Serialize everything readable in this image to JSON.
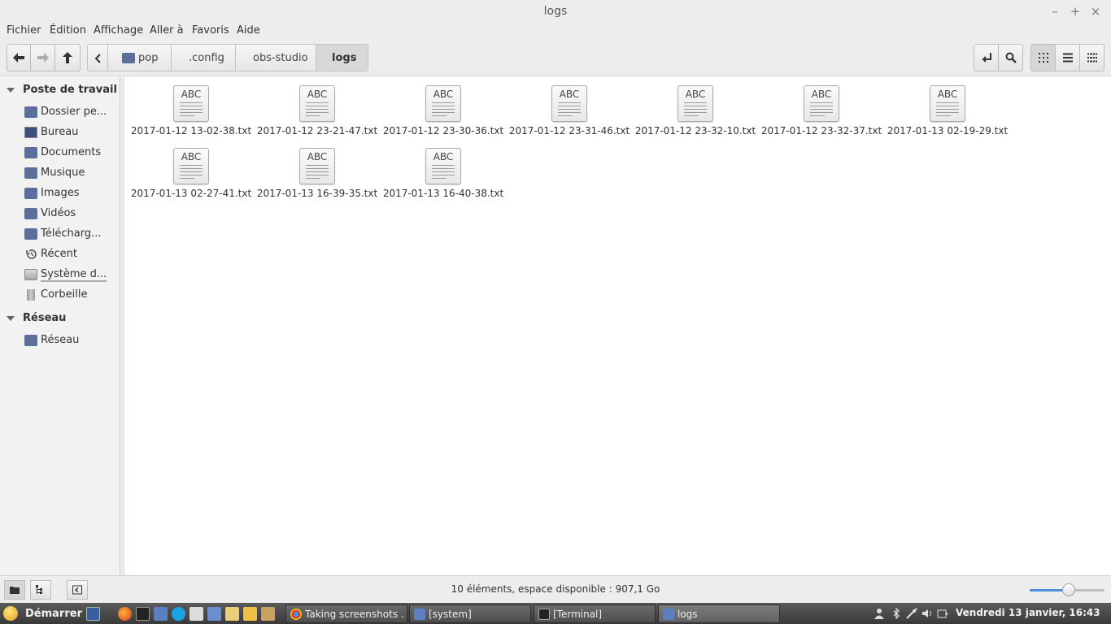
{
  "window": {
    "title": "logs",
    "controls": {
      "minimize": "–",
      "maximize": "+",
      "close": "×"
    }
  },
  "menubar": [
    "Fichier",
    "Édition",
    "Affichage",
    "Aller à",
    "Favoris",
    "Aide"
  ],
  "breadcrumb": [
    "pop",
    ".config",
    "obs-studio",
    "logs"
  ],
  "sidebar": {
    "sections": [
      {
        "label": "Poste de travail"
      },
      {
        "label": "Réseau"
      }
    ],
    "items": [
      {
        "label": "Dossier pe...",
        "icon": "home-folder-icon"
      },
      {
        "label": "Bureau",
        "icon": "desktop-icon"
      },
      {
        "label": "Documents",
        "icon": "documents-folder-icon"
      },
      {
        "label": "Musique",
        "icon": "music-folder-icon"
      },
      {
        "label": "Images",
        "icon": "pictures-folder-icon"
      },
      {
        "label": "Vidéos",
        "icon": "videos-folder-icon"
      },
      {
        "label": "Télécharg...",
        "icon": "downloads-folder-icon"
      },
      {
        "label": "Récent",
        "icon": "recent-icon"
      },
      {
        "label": "Système d...",
        "icon": "drive-icon"
      },
      {
        "label": "Corbeille",
        "icon": "trash-icon"
      }
    ],
    "network_items": [
      {
        "label": "Réseau",
        "icon": "network-icon"
      }
    ]
  },
  "files": [
    {
      "name": "2017-01-12 13-02-38.txt",
      "thumb": "ABC"
    },
    {
      "name": "2017-01-12 23-21-47.txt",
      "thumb": "ABC"
    },
    {
      "name": "2017-01-12 23-30-36.txt",
      "thumb": "ABC"
    },
    {
      "name": "2017-01-12 23-31-46.txt",
      "thumb": "ABC"
    },
    {
      "name": "2017-01-12 23-32-10.txt",
      "thumb": "ABC"
    },
    {
      "name": "2017-01-12 23-32-37.txt",
      "thumb": "ABC"
    },
    {
      "name": "2017-01-13 02-19-29.txt",
      "thumb": "ABC"
    },
    {
      "name": "2017-01-13 02-27-41.txt",
      "thumb": "ABC"
    },
    {
      "name": "2017-01-13 16-39-35.txt",
      "thumb": "ABC"
    },
    {
      "name": "2017-01-13 16-40-38.txt",
      "thumb": "ABC"
    }
  ],
  "status": {
    "text": "10 éléments, espace disponible : 907,1 Go",
    "zoom_level": 0.52
  },
  "taskbar": {
    "start_label": "Démarrer",
    "tasks": [
      {
        "label": "Taking screenshots ...",
        "icon": "chrome-icon"
      },
      {
        "label": "[system]",
        "icon": "folder-icon"
      },
      {
        "label": "[Terminal]",
        "icon": "terminal-icon"
      },
      {
        "label": "logs",
        "icon": "folder-icon"
      }
    ],
    "clock": "Vendredi 13 janvier, 16:43"
  },
  "colors": {
    "accent": "#4a90d9",
    "taskbar": "#4a4a4a"
  }
}
